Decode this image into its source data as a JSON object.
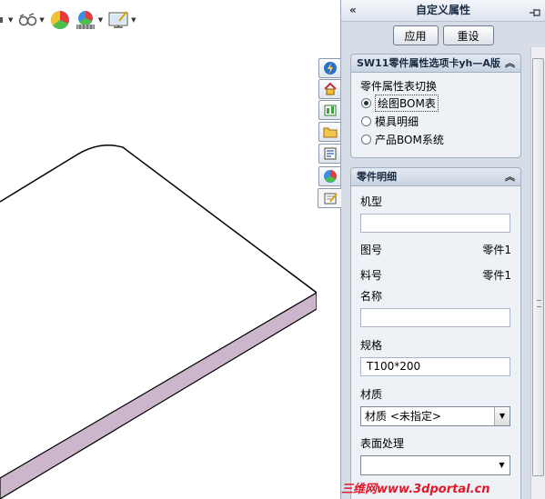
{
  "viewport": {
    "toolbar_icons": [
      "view-orientation-icon",
      "hide-show-items-icon",
      "appearance-icon",
      "scene-icon",
      "view-settings-icon"
    ]
  },
  "tabs": [
    "property-manager-icon",
    "home-icon",
    "table-icon",
    "folder-icon",
    "list-icon",
    "appearance-icon",
    "custom-properties-icon"
  ],
  "panel": {
    "collapse_glyph": "«",
    "title": "自定义属性",
    "apply_label": "应用",
    "reset_label": "重设"
  },
  "group1": {
    "header": "SW11零件属性选项卡yh—A版",
    "sublabel": "零件属性表切换",
    "options": [
      {
        "label": "绘图BOM表",
        "selected": true
      },
      {
        "label": "模具明细",
        "selected": false
      },
      {
        "label": "产品BOM系统",
        "selected": false
      }
    ]
  },
  "group2": {
    "header": "零件明细",
    "model_label": "机型",
    "model_value": "",
    "drawing_no_label": "图号",
    "drawing_no_value": "零件1",
    "material_no_label": "料号",
    "material_no_value": "零件1",
    "name_label": "名称",
    "name_value": "",
    "spec_label": "规格",
    "spec_value": "T100*200",
    "material_label": "材质",
    "material_value": "材质 <未指定>",
    "surface_label": "表面处理",
    "surface_value": ""
  },
  "watermark": "三维网www.3dportal.cn",
  "colors": {
    "panel_bg": "#d6dde7",
    "model_edge": "#c9b2c8",
    "watermark": "#e0182a"
  }
}
